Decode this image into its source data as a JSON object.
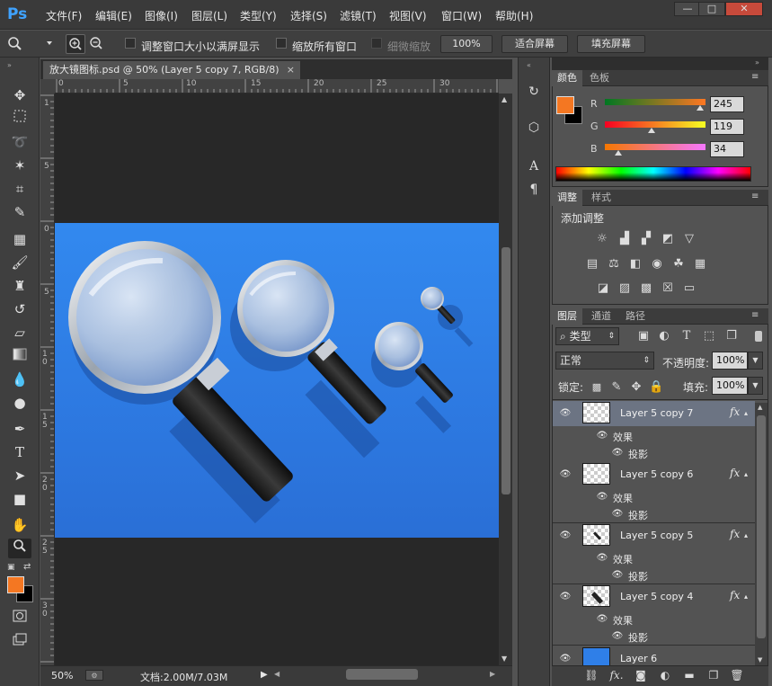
{
  "app": {
    "logo": "Ps"
  },
  "menu": [
    "文件(F)",
    "编辑(E)",
    "图像(I)",
    "图层(L)",
    "类型(Y)",
    "选择(S)",
    "滤镜(T)",
    "视图(V)",
    "窗口(W)",
    "帮助(H)"
  ],
  "window_controls": {
    "minimize": "—",
    "maximize": "□",
    "close": "✕"
  },
  "options": {
    "resize_windows": "调整窗口大小以满屏显示",
    "zoom_all": "缩放所有窗口",
    "scrubby_zoom": "细微缩放",
    "zoom_value": "100%",
    "fit_screen": "适合屏幕",
    "fill_screen": "填充屏幕"
  },
  "document": {
    "tab_title": "放大镜图标.psd @ 50% (Layer 5 copy 7, RGB/8)",
    "tab_close": "×",
    "ruler_h": [
      "0",
      "5",
      "10",
      "15",
      "20",
      "25",
      "30"
    ],
    "ruler_v": [
      "1",
      "5",
      "0",
      "5",
      "1 0",
      "1 5",
      "2 0",
      "2 5",
      "3 0"
    ],
    "zoom": "50%",
    "doc_info": "文档:2.00M/7.03M"
  },
  "color_panel": {
    "tabs": [
      "颜色",
      "色板"
    ],
    "foreground": "#f47722",
    "background": "#000000",
    "channels": [
      {
        "label": "R",
        "value": "245"
      },
      {
        "label": "G",
        "value": "119"
      },
      {
        "label": "B",
        "value": "34"
      }
    ]
  },
  "adjust_panel": {
    "tabs": [
      "调整",
      "样式"
    ],
    "title": "添加调整"
  },
  "layers_panel": {
    "tabs": [
      "图层",
      "通道",
      "路径"
    ],
    "filter": "类型",
    "blend_mode": "正常",
    "opacity_label": "不透明度:",
    "opacity": "100%",
    "lock_label": "锁定:",
    "fill_label": "填充:",
    "fill": "100%",
    "layers": [
      {
        "name": "Layer 5 copy 7",
        "effects": "效果",
        "shadow": "投影",
        "selected": true
      },
      {
        "name": "Layer 5 copy 6",
        "effects": "效果",
        "shadow": "投影",
        "selected": false
      },
      {
        "name": "Layer 5 copy 5",
        "effects": "效果",
        "shadow": "投影",
        "selected": false
      },
      {
        "name": "Layer 5 copy 4",
        "effects": "效果",
        "shadow": "投影",
        "selected": false
      },
      {
        "name": "Layer 6"
      }
    ],
    "fx": "fx"
  }
}
